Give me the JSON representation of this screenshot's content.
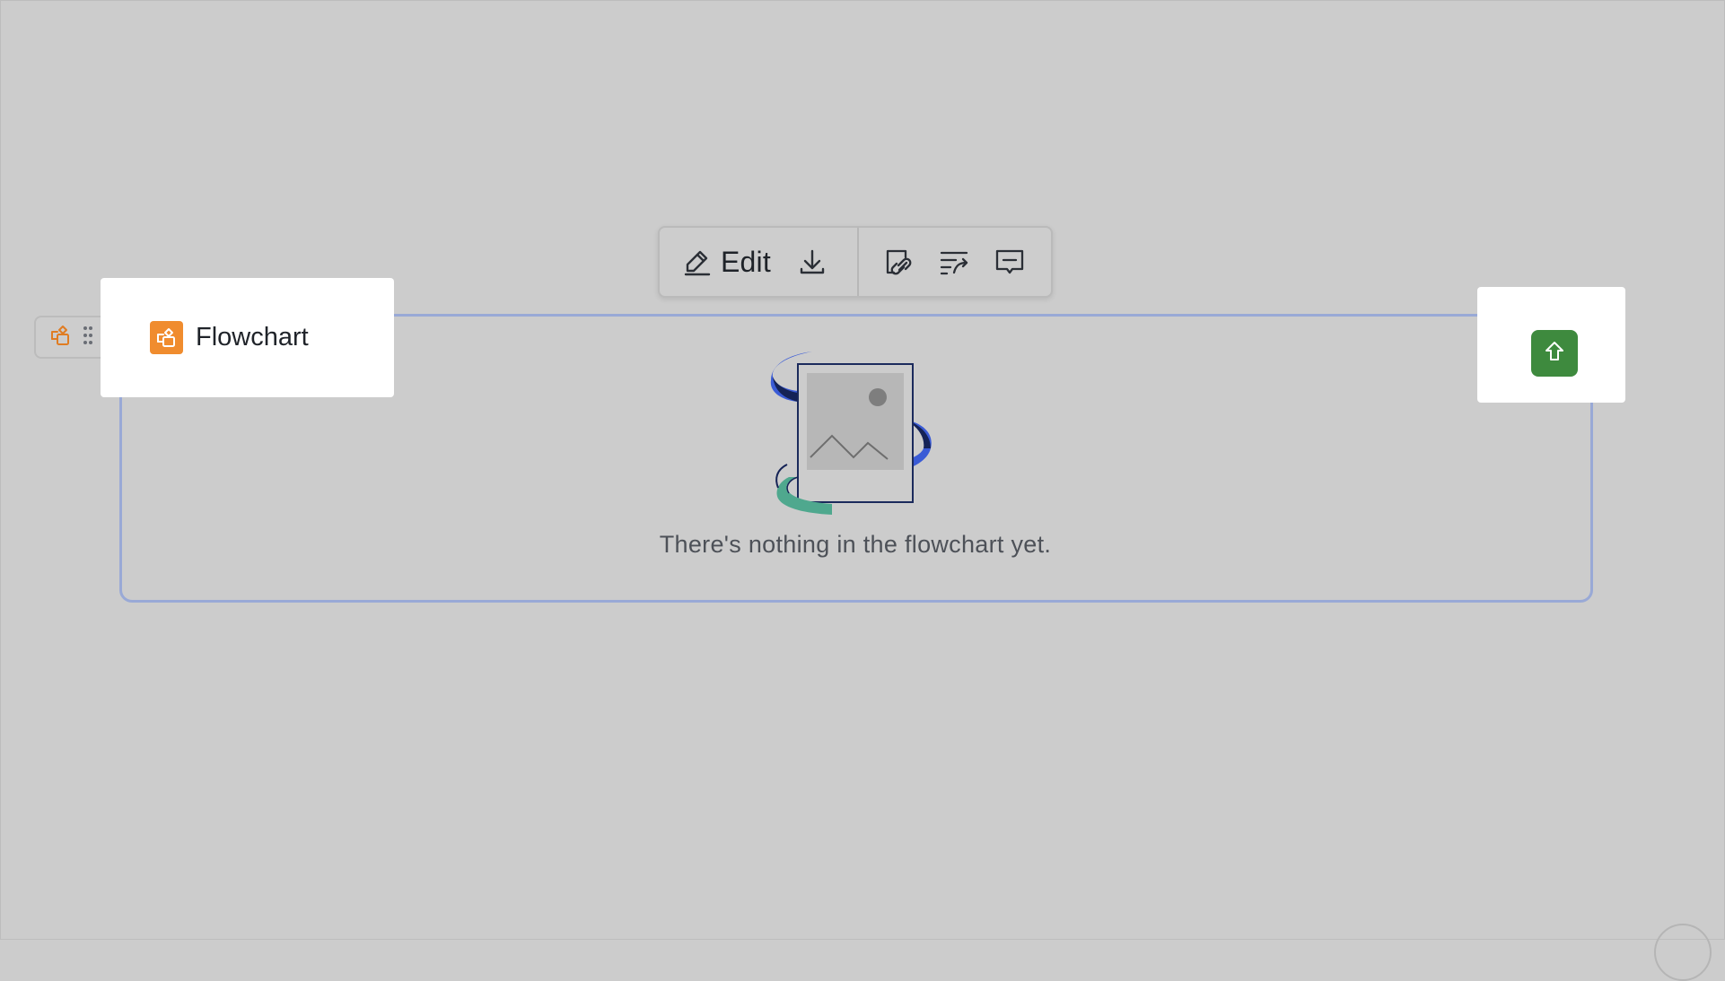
{
  "toolbar": {
    "edit_label": "Edit",
    "icons": [
      "edit-icon",
      "download-icon",
      "copy-link-icon",
      "text-wrap-icon",
      "comment-icon"
    ]
  },
  "block": {
    "title": "Flowchart",
    "title_icon": "flowchart-icon",
    "upload_icon": "arrow-up-icon",
    "empty_message": "There's nothing in the flowchart yet."
  },
  "colors": {
    "accent_orange": "#f08c2e",
    "upload_green": "#3e8a3e",
    "block_border": "#99a9d6",
    "overlay_gray": "#cccccc"
  }
}
